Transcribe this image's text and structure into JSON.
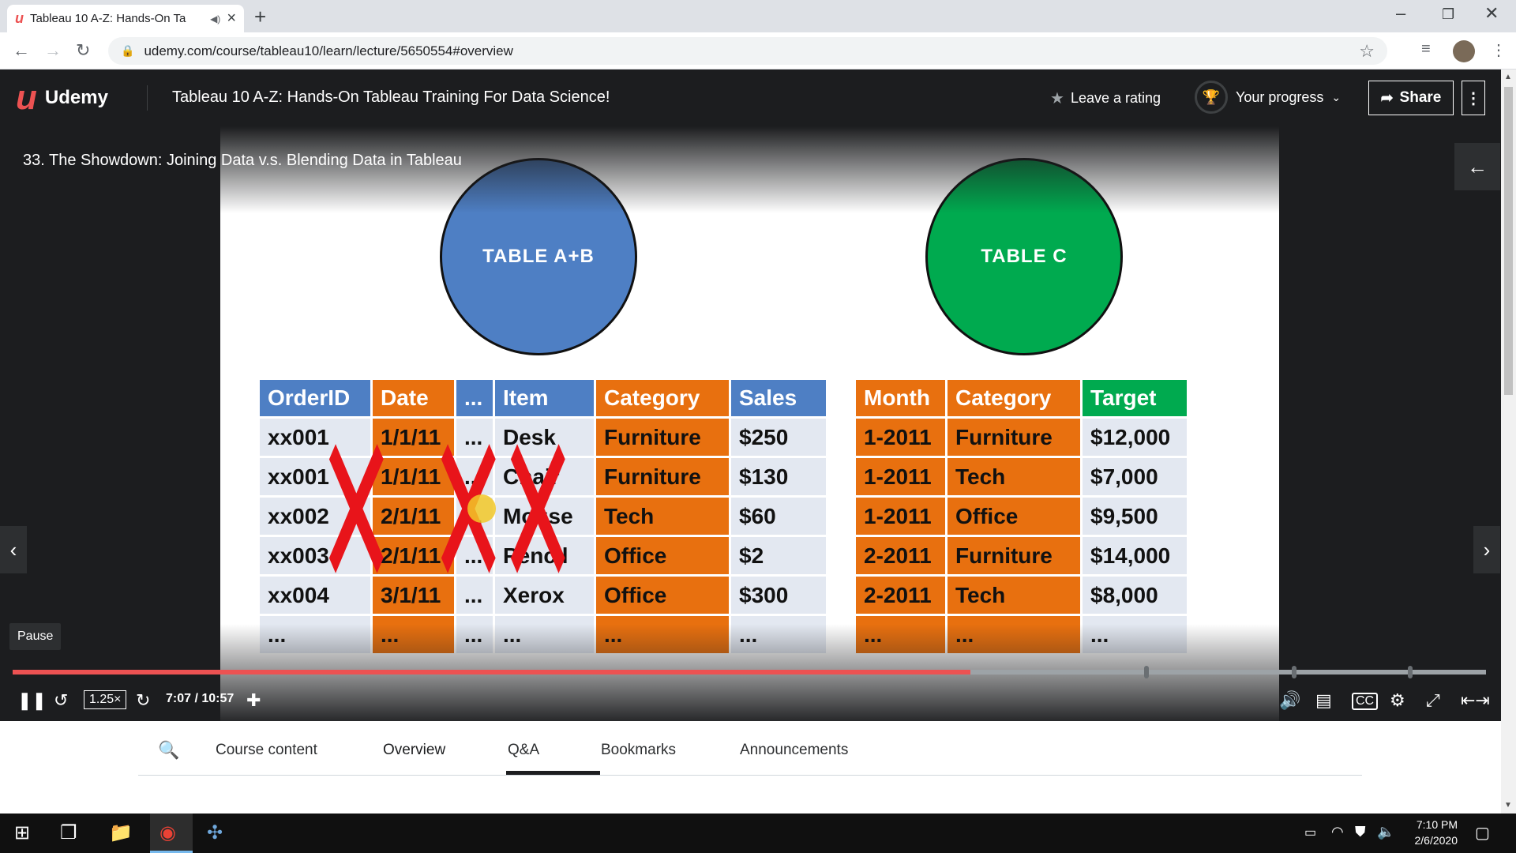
{
  "browser": {
    "tab_title": "Tableau 10 A-Z: Hands-On Ta",
    "url": "udemy.com/course/tableau10/learn/lecture/5650554#overview"
  },
  "header": {
    "brand": "Udemy",
    "course_title": "Tableau 10 A-Z: Hands-On Tableau Training For Data Science!",
    "rating_label": "Leave a rating",
    "progress_label": "Your progress",
    "share_label": "Share"
  },
  "video": {
    "lecture_title": "33. The Showdown: Joining Data v.s. Blending Data in Tableau",
    "circle_ab": "TABLE A+B",
    "circle_c": "TABLE C",
    "table_ab": {
      "headers": [
        "OrderID",
        "Date",
        "...",
        "Item",
        "Category",
        "Sales"
      ],
      "rows": [
        [
          "xx001",
          "1/1/11",
          "...",
          "Desk",
          "Furniture",
          "$250"
        ],
        [
          "xx001",
          "1/1/11",
          "...",
          "Chair",
          "Furniture",
          "$130"
        ],
        [
          "xx002",
          "2/1/11",
          "...",
          "Mouse",
          "Tech",
          "$60"
        ],
        [
          "xx003",
          "2/1/11",
          "...",
          "Pencil",
          "Office",
          "$2"
        ],
        [
          "xx004",
          "3/1/11",
          "...",
          "Xerox",
          "Office",
          "$300"
        ],
        [
          "...",
          "...",
          "...",
          "...",
          "...",
          "..."
        ]
      ]
    },
    "table_c": {
      "headers": [
        "Month",
        "Category",
        "Target"
      ],
      "rows": [
        [
          "1-2011",
          "Furniture",
          "$12,000"
        ],
        [
          "1-2011",
          "Tech",
          "$7,000"
        ],
        [
          "1-2011",
          "Office",
          "$9,500"
        ],
        [
          "2-2011",
          "Furniture",
          "$14,000"
        ],
        [
          "2-2011",
          "Tech",
          "$8,000"
        ],
        [
          "...",
          "...",
          "..."
        ]
      ]
    },
    "pause_tooltip": "Pause",
    "speed": "1.25×",
    "time": "7:07 / 10:57",
    "progress_fraction": 0.65
  },
  "page_tabs": [
    "Course content",
    "Overview",
    "Q&A",
    "Bookmarks",
    "Announcements"
  ],
  "active_tab": "Overview",
  "taskbar": {
    "time": "7:10 PM",
    "date": "2/6/2020"
  },
  "colors": {
    "udemy_red": "#ec5252",
    "table_blue": "#4e7fc4",
    "table_orange": "#e8700f",
    "table_green": "#00aa4f"
  }
}
